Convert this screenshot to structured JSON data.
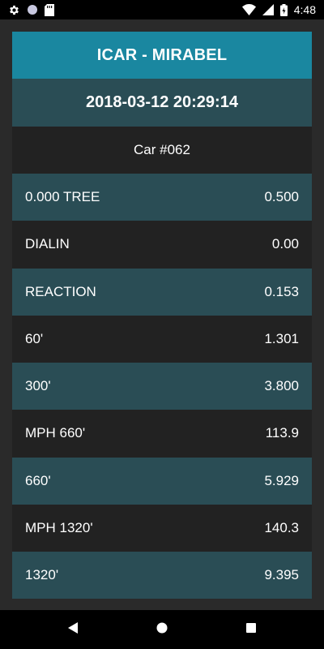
{
  "status_bar": {
    "time": "4:48",
    "icons": [
      "gear-icon",
      "circle-icon",
      "sd-card-icon",
      "wifi-icon",
      "signal-icon",
      "battery-icon"
    ]
  },
  "header": {
    "title": "ICAR - MIRABEL",
    "datetime": "2018-03-12 20:29:14",
    "car": "Car #062"
  },
  "rows": [
    {
      "label": "0.000 TREE",
      "value": "0.500"
    },
    {
      "label": "DIALIN",
      "value": "0.00"
    },
    {
      "label": "REACTION",
      "value": "0.153"
    },
    {
      "label": "60'",
      "value": "1.301"
    },
    {
      "label": "300'",
      "value": "3.800"
    },
    {
      "label": "MPH 660'",
      "value": "113.9"
    },
    {
      "label": "660'",
      "value": "5.929"
    },
    {
      "label": "MPH 1320'",
      "value": "140.3"
    },
    {
      "label": "1320'",
      "value": "9.395"
    }
  ],
  "nav_bar": {
    "buttons": [
      "back-icon",
      "home-icon",
      "recents-icon"
    ]
  },
  "colors": {
    "title_bg": "#1a87a0",
    "teal_row": "#2a4d55",
    "dark_row": "#222222",
    "outer_bg": "#2a2a2a"
  }
}
